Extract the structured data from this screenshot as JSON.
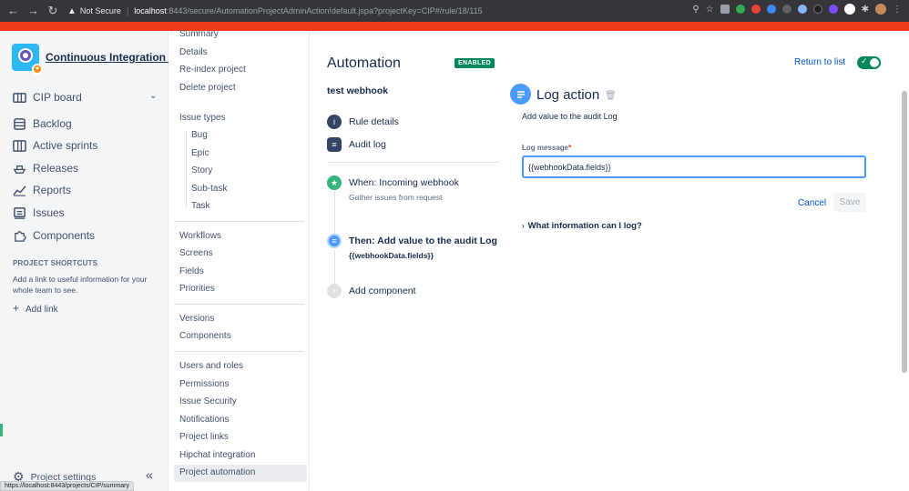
{
  "browser": {
    "security": "Not Secure",
    "url_host": "localhost",
    "url_path": ":8443/secure/AutomationProjectAdminAction!default.jspa?projectKey=CIP#/rule/18/115"
  },
  "status_url": "https://localhost:8443/projects/CIP/summary",
  "project": {
    "name": "Continuous Integration ..."
  },
  "sidebar": {
    "board": "CIP board",
    "items": [
      "Backlog",
      "Active sprints",
      "Releases",
      "Reports",
      "Issues",
      "Components"
    ],
    "shortcuts_title": "PROJECT SHORTCUTS",
    "shortcuts_text": "Add a link to useful information for your whole team to see.",
    "add_link": "Add link",
    "settings": "Project settings"
  },
  "settings_nav": {
    "summary": "Summary",
    "details": "Details",
    "reindex": "Re-index project",
    "delete": "Delete project",
    "issue_types": "Issue types",
    "issue_type_items": [
      "Bug",
      "Epic",
      "Story",
      "Sub-task",
      "Task"
    ],
    "workflows": "Workflows",
    "screens": "Screens",
    "fields": "Fields",
    "priorities": "Priorities",
    "versions": "Versions",
    "components": "Components",
    "users_roles": "Users and roles",
    "permissions": "Permissions",
    "issue_security": "Issue Security",
    "notifications": "Notifications",
    "project_links": "Project links",
    "hipchat": "Hipchat integration",
    "project_automation": "Project automation"
  },
  "automation": {
    "title": "Automation",
    "status_badge": "ENABLED",
    "rule_name": "test webhook",
    "rule_details": "Rule details",
    "audit_log": "Audit log",
    "trigger_title": "When: Incoming webhook",
    "trigger_sub": "Gather issues from request",
    "action_title": "Then: Add value to the audit Log",
    "action_sub": "{{webhookData.fields}}",
    "add_component": "Add component"
  },
  "panel": {
    "return_link": "Return to list",
    "title": "Log action",
    "description": "Add value to the audit Log",
    "field_label": "Log message",
    "required_mark": "*",
    "field_value": "{{webhookData.fields}}",
    "cancel": "Cancel",
    "save": "Save",
    "info_toggle": "What information can I log?"
  },
  "colors": {
    "enabled": "#00875a",
    "link": "#0052cc",
    "focus": "#4c9aff",
    "banner": "#ef3b1a"
  }
}
